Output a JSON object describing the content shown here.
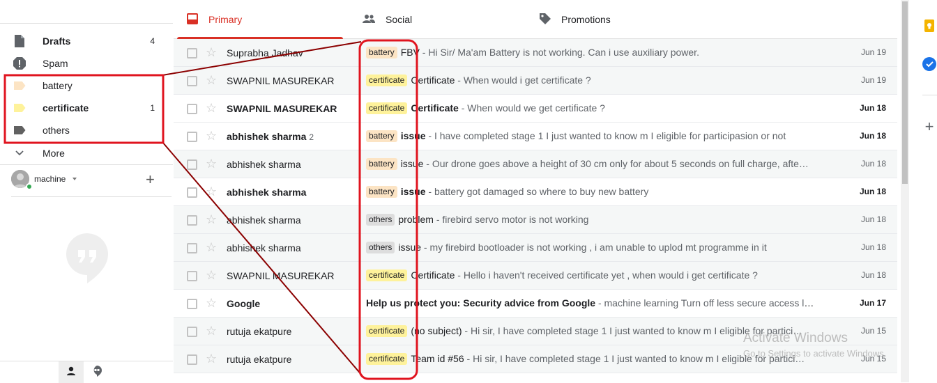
{
  "sidebar": {
    "items": [
      {
        "label": "Drafts",
        "count": "4",
        "icon": "file-icon",
        "bold": true
      },
      {
        "label": "Spam",
        "count": "",
        "icon": "spam-icon",
        "bold": false
      },
      {
        "label": "battery",
        "count": "",
        "icon": "label-icon",
        "color": "#fce4c4",
        "bold": false
      },
      {
        "label": "certificate",
        "count": "1",
        "icon": "label-icon",
        "color": "#fef29b",
        "bold": true
      },
      {
        "label": "others",
        "count": "",
        "icon": "label-icon",
        "color": "#616161",
        "bold": false
      }
    ],
    "more_label": "More",
    "user_name": "machine"
  },
  "tabs": [
    {
      "label": "Primary",
      "active": true,
      "icon": "inbox-icon"
    },
    {
      "label": "Social",
      "active": false,
      "icon": "people-icon"
    },
    {
      "label": "Promotions",
      "active": false,
      "icon": "tag-icon"
    }
  ],
  "emails": [
    {
      "sender": "Suprabha Jadhav",
      "count": "",
      "label": "battery",
      "subject": "FBV",
      "snippet": " - Hi Sir/ Ma'am Battery is not working. Can i use auxiliary power.",
      "date": "Jun 19",
      "unread": false
    },
    {
      "sender": "SWAPNIL MASUREKAR",
      "count": "",
      "label": "certificate",
      "subject": "Certificate",
      "snippet": " - When would i get certificate ?",
      "date": "Jun 19",
      "unread": false
    },
    {
      "sender": "SWAPNIL MASUREKAR",
      "count": "",
      "label": "certificate",
      "subject": "Certificate",
      "snippet": " - When would we get certificate ?",
      "date": "Jun 18",
      "unread": true
    },
    {
      "sender": "abhishek sharma",
      "count": "2",
      "label": "battery",
      "subject": "issue",
      "snippet": " - I have completed stage 1 I just wanted to know m I eligible for participasion or not",
      "date": "Jun 18",
      "unread": true
    },
    {
      "sender": "abhishek sharma",
      "count": "",
      "label": "battery",
      "subject": "issue",
      "snippet": " - Our drone goes above a height of 30 cm only for about 5 seconds on full charge, afte…",
      "date": "Jun 18",
      "unread": false
    },
    {
      "sender": "abhishek sharma",
      "count": "",
      "label": "battery",
      "subject": "issue",
      "snippet": " - battery got damaged so where to buy new battery",
      "date": "Jun 18",
      "unread": true
    },
    {
      "sender": "abhishek sharma",
      "count": "",
      "label": "others",
      "subject": "problem",
      "snippet": " - firebird servo motor is not working",
      "date": "Jun 18",
      "unread": false
    },
    {
      "sender": "abhishek sharma",
      "count": "",
      "label": "others",
      "subject": "issue",
      "snippet": " - my firebird bootloader is not working , i am unable to uplod mt programme in it",
      "date": "Jun 18",
      "unread": false
    },
    {
      "sender": "SWAPNIL MASUREKAR",
      "count": "",
      "label": "certificate",
      "subject": "Certificate",
      "snippet": " - Hello i haven't received certificate yet , when would i get certificate ?",
      "date": "Jun 18",
      "unread": false
    },
    {
      "sender": "Google",
      "count": "",
      "label": "",
      "subject": "Help us protect you: Security advice from Google",
      "snippet": " - machine learning Turn off less secure access lea…",
      "date": "Jun 17",
      "unread": true
    },
    {
      "sender": "rutuja ekatpure",
      "count": "",
      "label": "certificate",
      "subject": "(no subject)",
      "snippet": " - Hi sir, I have completed stage 1 I just wanted to know m I eligible for partici…",
      "date": "Jun 15",
      "unread": false
    },
    {
      "sender": "rutuja ekatpure",
      "count": "",
      "label": "certificate",
      "subject": "Team id #56",
      "snippet": " - Hi sir, I have completed stage 1 I just wanted to know m I eligible for partici…",
      "date": "Jun 15",
      "unread": false
    }
  ],
  "watermark": {
    "line1": "Activate Windows",
    "line2": "Go to Settings to activate Windows."
  },
  "colors": {
    "accent": "#d93025",
    "annotation": "#e0141f",
    "annotation_line": "#8b0000"
  }
}
